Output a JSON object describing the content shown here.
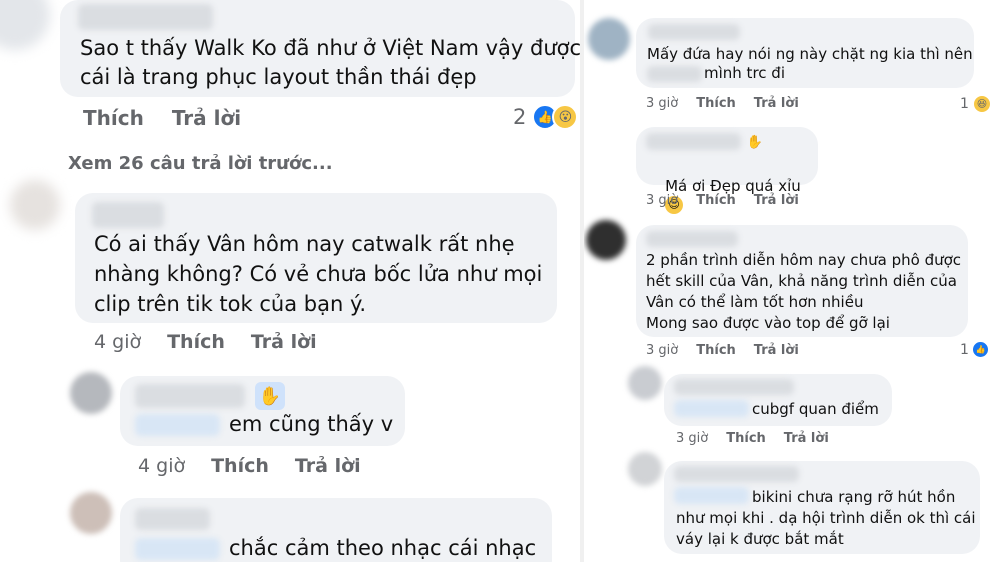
{
  "left": {
    "comment_1": {
      "text_line_1": "Sao t thấy Walk Ko đã như ở Việt Nam vậy được",
      "text_line_2": "cái là trang phục layout thần thái đẹp",
      "like_label": "Thích",
      "reply_label": "Trả lời",
      "reaction_count": "2"
    },
    "view_more_replies": "Xem 26 câu trả lời trước...",
    "comment_2": {
      "text_line_1": "Có ai thấy Vân hôm nay catwalk rất nhẹ",
      "text_line_2": "nhàng không? Có vẻ chưa bốc lửa như mọi",
      "text_line_3": "clip trên tik tok của bạn ý.",
      "time": "4 giờ",
      "like_label": "Thích",
      "reply_label": "Trả lời"
    },
    "comment_3": {
      "text": "em cũng thấy v",
      "time": "4 giờ",
      "like_label": "Thích",
      "reply_label": "Trả lời"
    },
    "comment_4": {
      "text": "chắc cảm theo nhạc cái nhạc"
    }
  },
  "right": {
    "comment_1": {
      "text_line_1": "Mấy đứa hay nói ng này chặt ng kia thì nên",
      "text_line_2": "mình trc đi",
      "time": "3 giờ",
      "like_label": "Thích",
      "reply_label": "Trả lời",
      "reaction_count": "1"
    },
    "comment_2": {
      "text": "Má ơi Đẹp quá xỉu",
      "time": "3 giờ",
      "like_label": "Thích",
      "reply_label": "Trả lời"
    },
    "comment_3": {
      "text_line_1": "2 phần trình diễn hôm nay chưa phô được",
      "text_line_2": "hết skill của Vân, khả năng trình diễn của",
      "text_line_3": "Vân có thể làm tốt hơn nhiều",
      "text_line_4": "Mong sao được vào top để gỡ lại",
      "time": "3 giờ",
      "like_label": "Thích",
      "reply_label": "Trả lời",
      "reaction_count": "1"
    },
    "comment_4": {
      "text": "cubgf quan điểm",
      "time": "3 giờ",
      "like_label": "Thích",
      "reply_label": "Trả lời"
    },
    "comment_5": {
      "text_line_1": "bikini chưa rạng rỡ hút hồn",
      "text_line_2": "như mọi khi . dạ hội trình diễn ok thì cái",
      "text_line_3": "váy lại k được bắt mắt"
    }
  },
  "colors": {
    "bubble": "#f0f2f5",
    "action_text": "#65676b",
    "like_blue": "#1877f2",
    "reaction_yellow": "#f7c744"
  }
}
